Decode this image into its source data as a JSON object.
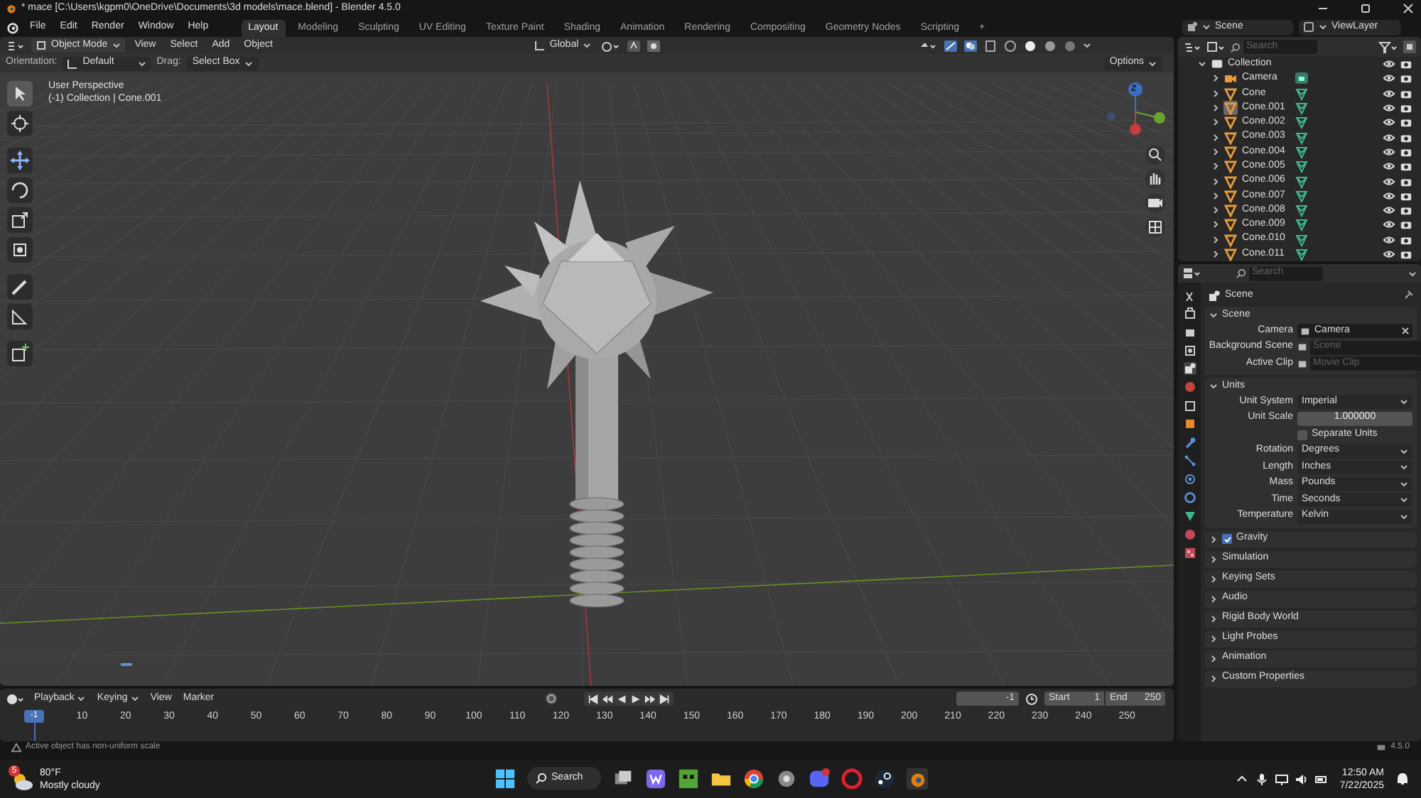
{
  "window": {
    "title": "* mace [C:\\Users\\kgpm0\\OneDrive\\Documents\\3d models\\mace.blend] - Blender 4.5.0"
  },
  "menu": [
    "File",
    "Edit",
    "Render",
    "Window",
    "Help"
  ],
  "workspaces": [
    {
      "label": "Layout",
      "selected": true
    },
    {
      "label": "Modeling",
      "selected": false
    },
    {
      "label": "Sculpting",
      "selected": false
    },
    {
      "label": "UV Editing",
      "selected": false
    },
    {
      "label": "Texture Paint",
      "selected": false
    },
    {
      "label": "Shading",
      "selected": false
    },
    {
      "label": "Animation",
      "selected": false
    },
    {
      "label": "Rendering",
      "selected": false
    },
    {
      "label": "Compositing",
      "selected": false
    },
    {
      "label": "Geometry Nodes",
      "selected": false
    },
    {
      "label": "Scripting",
      "selected": false
    },
    {
      "label": "+",
      "selected": false
    }
  ],
  "scene": "Scene",
  "view_layer": "ViewLayer",
  "viewport": {
    "mode": "Object Mode",
    "menu": [
      "View",
      "Select",
      "Add",
      "Object"
    ],
    "transform": "Global",
    "orientation_label": "Orientation:",
    "orientation": "Default",
    "drag_label": "Drag:",
    "drag": "Select Box",
    "options": "Options",
    "overlay_title": "User Perspective",
    "overlay_subtitle": "(-1) Collection | Cone.001",
    "gizmo_label": "Z",
    "tools": [
      {
        "selected": true
      },
      {
        "selected": false
      },
      {
        "selected": false
      },
      {
        "selected": false
      },
      {
        "selected": false
      },
      {
        "selected": false
      },
      {
        "selected": false
      },
      {
        "selected": false
      },
      {
        "selected": false
      }
    ]
  },
  "outliner": {
    "search_placeholder": "Search",
    "collection": "Collection",
    "items": [
      {
        "name": "Camera",
        "kind": "camera",
        "selected": false
      },
      {
        "name": "Cone",
        "kind": "mesh",
        "selected": false
      },
      {
        "name": "Cone.001",
        "kind": "mesh",
        "selected": true
      },
      {
        "name": "Cone.002",
        "kind": "mesh",
        "selected": false
      },
      {
        "name": "Cone.003",
        "kind": "mesh",
        "selected": false
      },
      {
        "name": "Cone.004",
        "kind": "mesh",
        "selected": false
      },
      {
        "name": "Cone.005",
        "kind": "mesh",
        "selected": false
      },
      {
        "name": "Cone.006",
        "kind": "mesh",
        "selected": false
      },
      {
        "name": "Cone.007",
        "kind": "mesh",
        "selected": false
      },
      {
        "name": "Cone.008",
        "kind": "mesh",
        "selected": false
      },
      {
        "name": "Cone.009",
        "kind": "mesh",
        "selected": false
      },
      {
        "name": "Cone.010",
        "kind": "mesh",
        "selected": false
      },
      {
        "name": "Cone.011",
        "kind": "mesh",
        "selected": false
      }
    ]
  },
  "properties": {
    "search_placeholder": "Search",
    "context": "Scene",
    "panels": [
      {
        "title": "Scene",
        "expanded": true,
        "fields": [
          {
            "kind": "object",
            "label": "Camera",
            "value": "Camera"
          },
          {
            "kind": "object",
            "label": "Background Scene",
            "placeholder": "Scene"
          },
          {
            "kind": "object",
            "label": "Active Clip",
            "placeholder": "Movie Clip"
          }
        ]
      },
      {
        "title": "Units",
        "expanded": true,
        "fields": [
          {
            "kind": "dropdown",
            "label": "Unit System",
            "value": "Imperial"
          },
          {
            "kind": "number",
            "label": "Unit Scale",
            "value": "1.000000"
          },
          {
            "kind": "checkbox",
            "label": "Separate Units",
            "checked": false
          },
          {
            "kind": "dropdown",
            "label": "Rotation",
            "value": "Degrees"
          },
          {
            "kind": "dropdown",
            "label": "Length",
            "value": "Inches"
          },
          {
            "kind": "dropdown",
            "label": "Mass",
            "value": "Pounds"
          },
          {
            "kind": "dropdown",
            "label": "Time",
            "value": "Seconds"
          },
          {
            "kind": "dropdown",
            "label": "Temperature",
            "value": "Kelvin"
          }
        ]
      },
      {
        "title": "Gravity",
        "expanded": false,
        "checked": true
      },
      {
        "title": "Simulation",
        "expanded": false
      },
      {
        "title": "Keying Sets",
        "expanded": false
      },
      {
        "title": "Audio",
        "expanded": false
      },
      {
        "title": "Rigid Body World",
        "expanded": false
      },
      {
        "title": "Light Probes",
        "expanded": false
      },
      {
        "title": "Animation",
        "expanded": false
      },
      {
        "title": "Custom Properties",
        "expanded": false
      }
    ]
  },
  "timeline": {
    "menu": [
      "Playback",
      "Keying",
      "View",
      "Marker"
    ],
    "current_frame": "-1",
    "start_label": "Start",
    "start": "1",
    "end_label": "End",
    "end": "250",
    "playhead": "-1",
    "ticks": [
      "10",
      "20",
      "30",
      "40",
      "50",
      "60",
      "70",
      "80",
      "90",
      "100",
      "110",
      "120",
      "130",
      "140",
      "150",
      "160",
      "170",
      "180",
      "190",
      "200",
      "210",
      "220",
      "230",
      "240",
      "250"
    ]
  },
  "status_bar": {
    "message": "Active object has non-uniform scale",
    "version": "4.5.0"
  },
  "taskbar": {
    "weather_badge": "5",
    "temperature": "80°F",
    "weather": "Mostly cloudy",
    "search": "Search",
    "time": "12:50 AM",
    "date": "7/22/2025"
  }
}
